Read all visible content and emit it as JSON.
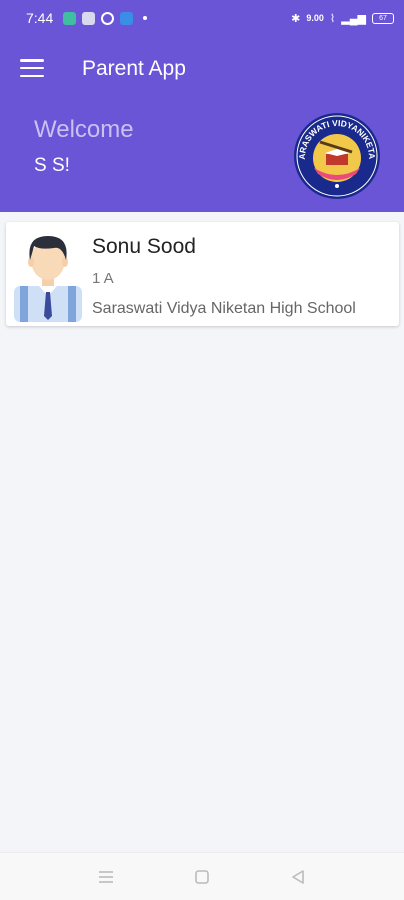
{
  "status_bar": {
    "time": "7:44",
    "speed": "9.00",
    "battery": "67"
  },
  "app_bar": {
    "title": "Parent App",
    "welcome": "Welcome",
    "user": "S S!"
  },
  "logo": {
    "text": "SARASWATI VIDYANIKETAN"
  },
  "student": {
    "name": "Sonu Sood",
    "class": "1 A",
    "school": "Saraswati Vidya Niketan High School"
  },
  "colors": {
    "primary": "#6a55d6",
    "welcome_text": "#c8c2f3",
    "background": "#f4f5f9"
  }
}
